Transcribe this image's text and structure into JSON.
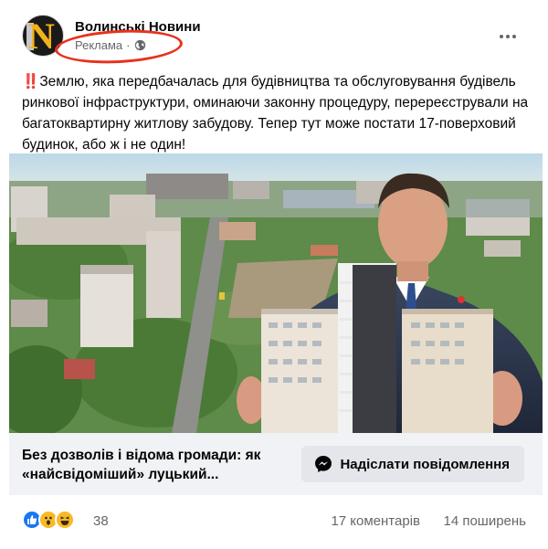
{
  "post": {
    "page_name": "Волинські Новини",
    "sponsored_label": "Реклама",
    "separator": "·",
    "alert_icon": "‼️",
    "text": "Землю, яка передбачалась для будівництва та обслуговування будівель ринкової інфраструктури, оминаючи законну процедуру, перереєстрували на багатоквартирну житлову забудову. Тепер тут може постати 17-поверховий будинок, або ж і не один!",
    "avatar_letter": "N",
    "accent_color": "#e8311c"
  },
  "cta": {
    "title": "Без дозволів і відома громади: як «найсвідоміший» луцький...",
    "button_label": "Надіслати повідомлення"
  },
  "stats": {
    "reaction_count": "38",
    "comments": "17 коментарів",
    "shares": "14 поширень",
    "reactions": [
      "like-icon",
      "wow-icon",
      "haha-icon"
    ]
  }
}
